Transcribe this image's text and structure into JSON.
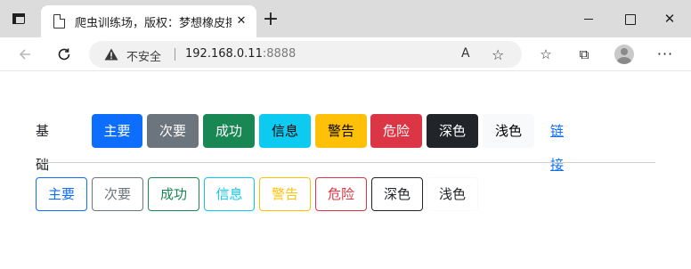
{
  "browser": {
    "tab_title": "爬虫训练场，版权：梦想橡皮擦",
    "tab_close": "✕",
    "new_tab": "+",
    "window_close": "✕",
    "security_label": "不安全",
    "url_host": "192.168.0.11",
    "url_port": ":8888",
    "read_aloud": "A",
    "favorites_add": "☆",
    "favorites": "☆",
    "collections": "⧉",
    "more": "···",
    "icons": [
      "tab-actions-icon",
      "document-icon",
      "back-arrow-icon",
      "reload-icon",
      "warning-icon",
      "read-aloud-icon",
      "add-favorite-icon",
      "favorites-icon",
      "collections-icon",
      "profile-icon",
      "more-icon"
    ]
  },
  "page": {
    "row1_label": "基础",
    "solid_buttons": [
      {
        "label": "主要",
        "variant": "primary"
      },
      {
        "label": "次要",
        "variant": "secondary"
      },
      {
        "label": "成功",
        "variant": "success"
      },
      {
        "label": "信息",
        "variant": "info"
      },
      {
        "label": "警告",
        "variant": "warning"
      },
      {
        "label": "危险",
        "variant": "danger"
      },
      {
        "label": "深色",
        "variant": "dark"
      },
      {
        "label": "浅色",
        "variant": "light"
      }
    ],
    "link_label": "链接",
    "outline_buttons": [
      {
        "label": "主要",
        "variant": "primary"
      },
      {
        "label": "次要",
        "variant": "secondary"
      },
      {
        "label": "成功",
        "variant": "success"
      },
      {
        "label": "信息",
        "variant": "info"
      },
      {
        "label": "警告",
        "variant": "warning"
      },
      {
        "label": "危险",
        "variant": "danger"
      },
      {
        "label": "深色",
        "variant": "dark"
      },
      {
        "label": "浅色",
        "variant": "light"
      }
    ]
  },
  "colors": {
    "primary": "#0d6efd",
    "secondary": "#6c757d",
    "success": "#198754",
    "info": "#0dcaf0",
    "warning": "#ffc107",
    "danger": "#dc3545",
    "dark": "#212529",
    "light": "#f8f9fa"
  }
}
